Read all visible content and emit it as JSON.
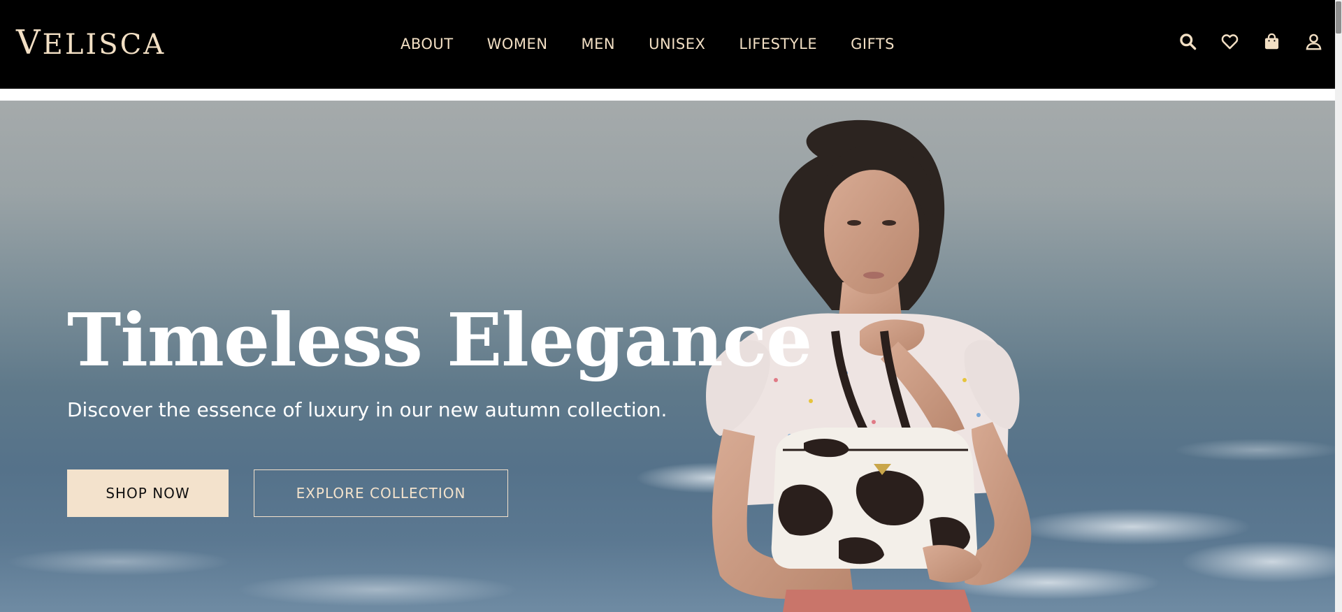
{
  "header": {
    "logo": {
      "first_letter": "V",
      "rest": "ELISCA"
    },
    "nav": [
      "ABOUT",
      "WOMEN",
      "MEN",
      "UNISEX",
      "LIFESTYLE",
      "GIFTS"
    ],
    "icons": [
      "search-icon",
      "heart-icon",
      "shopping-bag-icon",
      "user-icon"
    ]
  },
  "hero": {
    "title": "Timeless Elegance",
    "subtitle": "Discover the essence of luxury in our new autumn collection.",
    "primary_button": "SHOP NOW",
    "secondary_button": "EXPLORE COLLECTION"
  },
  "colors": {
    "header_bg": "#000000",
    "accent_cream": "#f3e2cc",
    "hero_sky": "#a5aaab",
    "hero_water": "#55728a"
  }
}
